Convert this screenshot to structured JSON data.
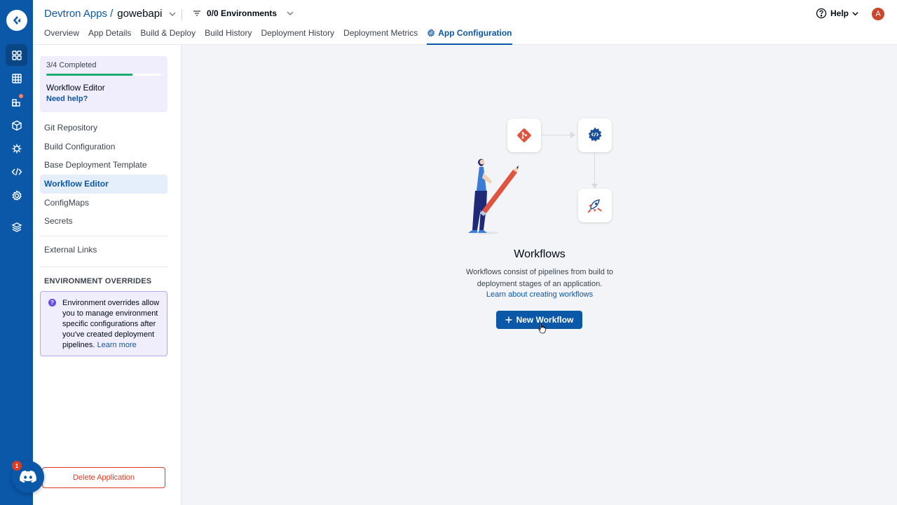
{
  "header": {
    "breadcrumb_root": "Devtron Apps",
    "breadcrumb_sep": "/",
    "app_name": "gowebapi",
    "env_filter": "0/0 Environments",
    "help": "Help",
    "avatar_initial": "A"
  },
  "tabs": [
    {
      "label": "Overview"
    },
    {
      "label": "App Details"
    },
    {
      "label": "Build & Deploy"
    },
    {
      "label": "Build History"
    },
    {
      "label": "Deployment History"
    },
    {
      "label": "Deployment Metrics"
    },
    {
      "label": "App Configuration"
    }
  ],
  "sidebar": {
    "progress_text": "3/4 Completed",
    "progress_fraction": 0.75,
    "progress_title": "Workflow Editor",
    "progress_help": "Need help?",
    "items": [
      {
        "label": "Git Repository"
      },
      {
        "label": "Build Configuration"
      },
      {
        "label": "Base Deployment Template"
      },
      {
        "label": "Workflow Editor"
      },
      {
        "label": "ConfigMaps"
      },
      {
        "label": "Secrets"
      }
    ],
    "external_links": "External Links",
    "env_overrides_heading": "ENVIRONMENT OVERRIDES",
    "env_info_icon": "?",
    "env_info_text": "Environment overrides allow you to manage environment specific configurations after you've created deployment pipelines.",
    "env_info_link": "Learn more",
    "delete_button": "Delete Application"
  },
  "main": {
    "title": "Workflows",
    "description": "Workflows consist of pipelines from build to deployment stages of an application.",
    "link": "Learn about creating workflows",
    "button": "New Workflow"
  },
  "discord_badge": "1",
  "colors": {
    "brand": "#0b57a8",
    "rail": "#0b57a8",
    "success": "#1dad70",
    "danger": "#dd3c22",
    "info_bg": "#f0eefc"
  },
  "icons": {
    "rail": [
      "devtron-logo-icon",
      "apps-grid-icon",
      "resource-browser-icon",
      "charts-icon",
      "cube-icon",
      "bug-icon",
      "code-icon",
      "settings-gear-icon",
      "stack-icon"
    ],
    "nodes": [
      "git-icon",
      "build-gear-icon",
      "deploy-rocket-icon"
    ]
  }
}
